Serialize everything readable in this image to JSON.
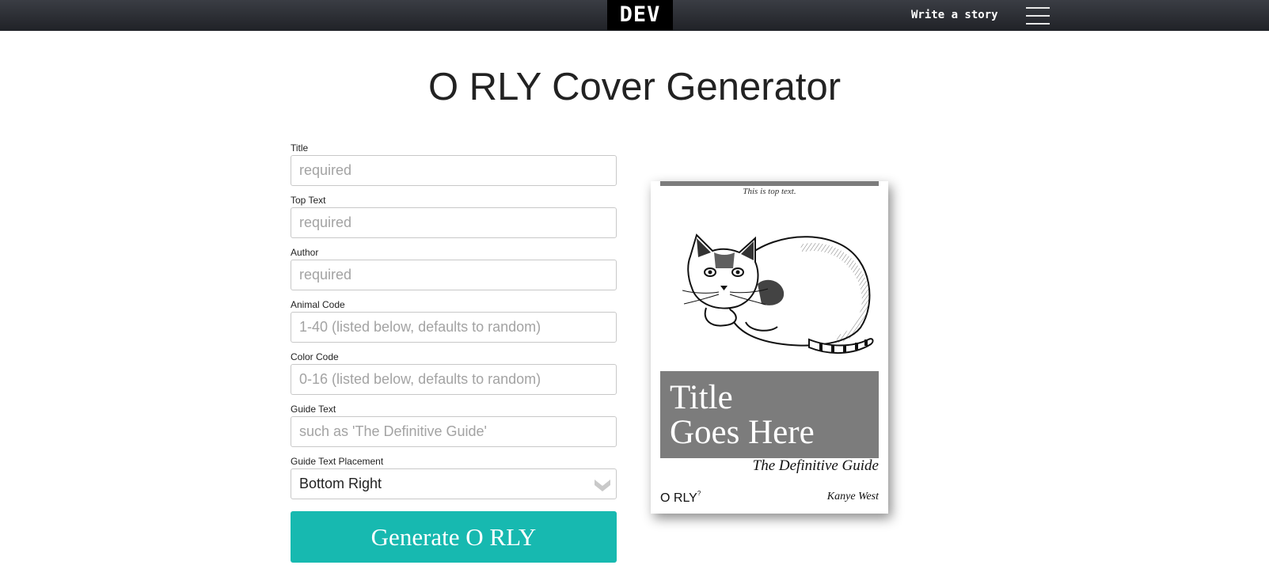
{
  "nav": {
    "logo": "DEV",
    "write_link": "Write a story",
    "menu_icon": "hamburger-menu-icon"
  },
  "page": {
    "title": "O RLY Cover Generator"
  },
  "form": {
    "title": {
      "label": "Title",
      "placeholder": "required",
      "value": ""
    },
    "top_text": {
      "label": "Top Text",
      "placeholder": "required",
      "value": ""
    },
    "author": {
      "label": "Author",
      "placeholder": "required",
      "value": ""
    },
    "animal_code": {
      "label": "Animal Code",
      "placeholder": "1-40 (listed below, defaults to random)",
      "value": ""
    },
    "color_code": {
      "label": "Color Code",
      "placeholder": "0-16 (listed below, defaults to random)",
      "value": ""
    },
    "guide_text": {
      "label": "Guide Text",
      "placeholder": "such as 'The Definitive Guide'",
      "value": ""
    },
    "placement": {
      "label": "Guide Text Placement",
      "selected": "Bottom Right",
      "icon": "chevron-down-icon"
    },
    "submit_label": "Generate O RLY"
  },
  "preview": {
    "top_text": "This is top text.",
    "title_line1": "Title",
    "title_line2": "Goes Here",
    "guide_text": "The Definitive Guide",
    "brand": "O RLY",
    "brand_mark": "?",
    "author": "Kanye West",
    "animal_icon": "cat-illustration",
    "accent_color": "#7c7c7c"
  },
  "colors": {
    "nav_background": "#25272c",
    "button": "#17b9b0",
    "cover_accent": "#7c7c7c"
  }
}
